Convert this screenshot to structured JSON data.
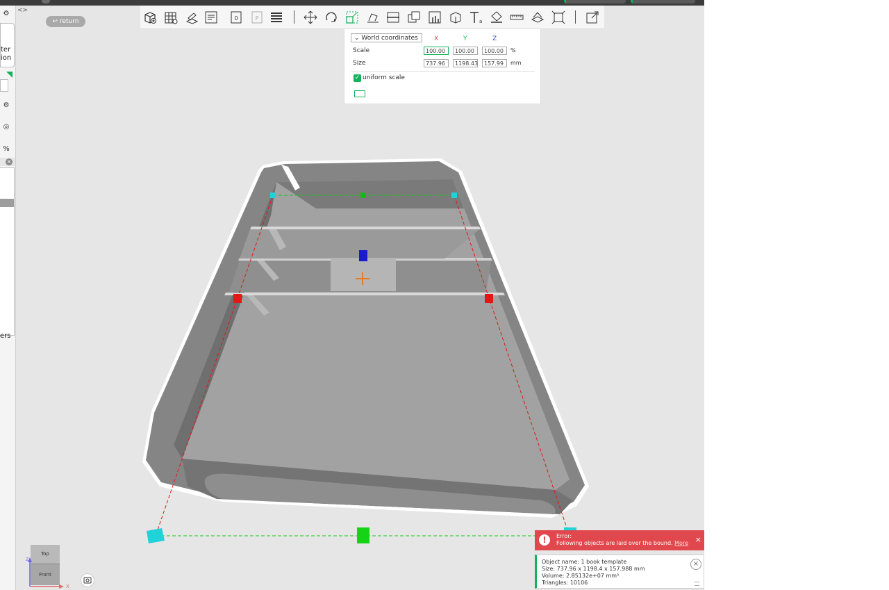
{
  "toolbar": {
    "tools": [
      {
        "name": "add-part-tool",
        "icon": "add-cube-icon"
      },
      {
        "name": "arrange-tool",
        "icon": "grid-icon"
      },
      {
        "name": "orient-tool",
        "icon": "orient-icon"
      },
      {
        "name": "plate-tool",
        "icon": "plate-icon"
      },
      {
        "name": "plate-settings-tool",
        "icon": "plate-settings-icon"
      },
      {
        "name": "plate-preview-tool",
        "icon": "plate-p-icon"
      },
      {
        "name": "layers-tool",
        "icon": "layers-icon"
      },
      {
        "name": "move-tool",
        "icon": "move-icon"
      },
      {
        "name": "rotate-tool",
        "icon": "rotate-icon"
      },
      {
        "name": "scale-tool",
        "icon": "scale-icon"
      },
      {
        "name": "lay-on-face-tool",
        "icon": "lay-flat-icon"
      },
      {
        "name": "cut-tool",
        "icon": "cut-icon"
      },
      {
        "name": "mesh-boolean-tool",
        "icon": "boolean-icon"
      },
      {
        "name": "support-paint-tool",
        "icon": "support-paint-icon"
      },
      {
        "name": "seam-paint-tool",
        "icon": "seam-icon"
      },
      {
        "name": "text-tool",
        "icon": "text-icon"
      },
      {
        "name": "color-paint-tool",
        "icon": "paint-bucket-icon"
      },
      {
        "name": "measure-tool",
        "icon": "ruler-icon"
      },
      {
        "name": "assembly-tool",
        "icon": "assembly-icon"
      },
      {
        "name": "fit-view-tool",
        "icon": "fit-view-icon"
      },
      {
        "name": "view-settings-tool",
        "icon": "view-settings-icon"
      }
    ]
  },
  "left_panel": {
    "text_top": "ter",
    "text_top2": "ion",
    "text_bottom": "ers",
    "pct_icon": "%"
  },
  "viewport": {
    "return_label": "return",
    "collapse_icon": "<>"
  },
  "scale_panel": {
    "coordinate_mode": "World coordinates",
    "axis_x": "X",
    "axis_y": "Y",
    "axis_z": "Z",
    "scale_label": "Scale",
    "scale_x": "100.00",
    "scale_y": "100.00",
    "scale_z": "100.00",
    "scale_unit": "%",
    "size_label": "Size",
    "size_x": "737.96",
    "size_y": "1198.43",
    "size_z": "157.99",
    "size_unit": "mm",
    "uniform_scale_label": "uniform scale",
    "uniform_scale_checked": true
  },
  "error_toast": {
    "title": "Error:",
    "message": "Following objects are laid over the bound.",
    "more_link": "More",
    "close": "×"
  },
  "info_toast": {
    "object_name": "Object name: 1 book template",
    "size": "Size: 737.96 x 1198.4 x 157.988 mm",
    "volume": "Volume: 2.85132e+07 mm³",
    "triangles": "Triangles: 10106"
  },
  "nav_cube": {
    "top_label": "Top",
    "front_label": "Front",
    "axis_x_label": "X",
    "axis_z_label": "Z"
  },
  "colors": {
    "accent": "#12b25b",
    "error": "#e0484d",
    "viewport_bg": "#e6e6e6",
    "model_gray": "#8c8c8c",
    "handle_cyan": "#1fd3d8",
    "handle_green": "#17b817",
    "handle_red": "#e01818",
    "handle_blue": "#1a1ad0"
  }
}
